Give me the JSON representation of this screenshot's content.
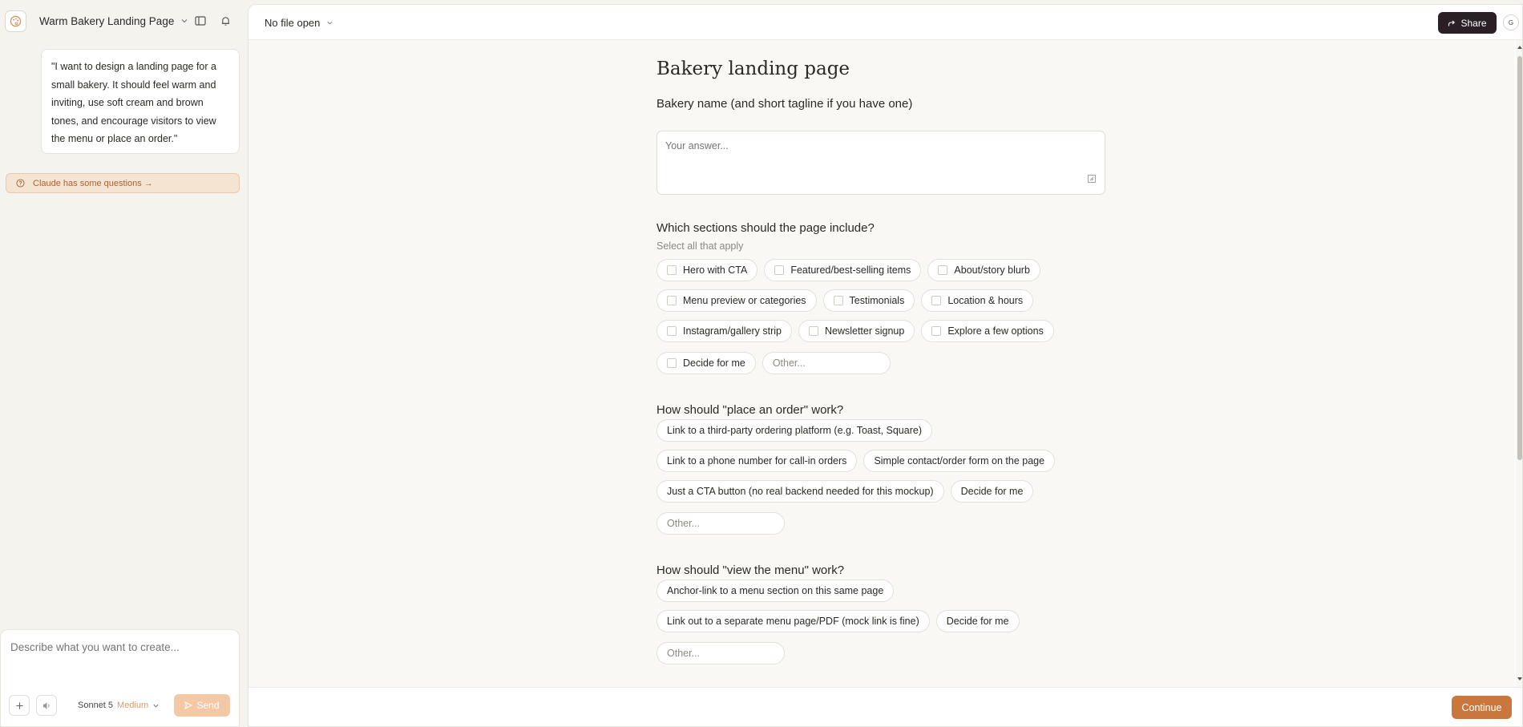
{
  "sidebar": {
    "project_title": "Warm Bakery Landing Page",
    "user_message": "\"I want to design a landing page for a small bakery. It should feel warm and inviting, use soft cream and brown tones, and encourage visitors to view the menu or place an order.\"",
    "questions_notice": "Claude has some questions →",
    "composer": {
      "placeholder": "Describe what you want to create...",
      "model": "Sonnet 5",
      "effort": "Medium",
      "send_label": "Send"
    }
  },
  "topbar": {
    "file_label": "No file open",
    "share_label": "Share",
    "avatar_initial": "G"
  },
  "form": {
    "title": "Bakery landing page",
    "q1": {
      "label": "Bakery name (and short tagline if you have one)",
      "placeholder": "Your answer..."
    },
    "q2": {
      "label": "Which sections should the page include?",
      "hint": "Select all that apply",
      "options": [
        "Hero with CTA",
        "Featured/best-selling items",
        "About/story blurb",
        "Menu preview or categories",
        "Testimonials",
        "Location & hours",
        "Instagram/gallery strip",
        "Newsletter signup",
        "Explore a few options",
        "Decide for me"
      ],
      "other_placeholder": "Other..."
    },
    "q3": {
      "label": "How should \"place an order\" work?",
      "options": [
        "Link to a third-party ordering platform (e.g. Toast, Square)",
        "Link to a phone number for call-in orders",
        "Simple contact/order form on the page",
        "Just a CTA button (no real backend needed for this mockup)",
        "Decide for me"
      ],
      "other_placeholder": "Other..."
    },
    "q4": {
      "label": "How should \"view the menu\" work?",
      "options": [
        "Anchor-link to a menu section on this same page",
        "Link out to a separate menu page/PDF (mock link is fine)",
        "Decide for me"
      ],
      "other_placeholder": "Other..."
    }
  },
  "footer": {
    "continue_label": "Continue"
  },
  "colors": {
    "accent": "#c9773d",
    "share_bg": "#2a1f25",
    "notice_bg": "#f6e4d2"
  }
}
